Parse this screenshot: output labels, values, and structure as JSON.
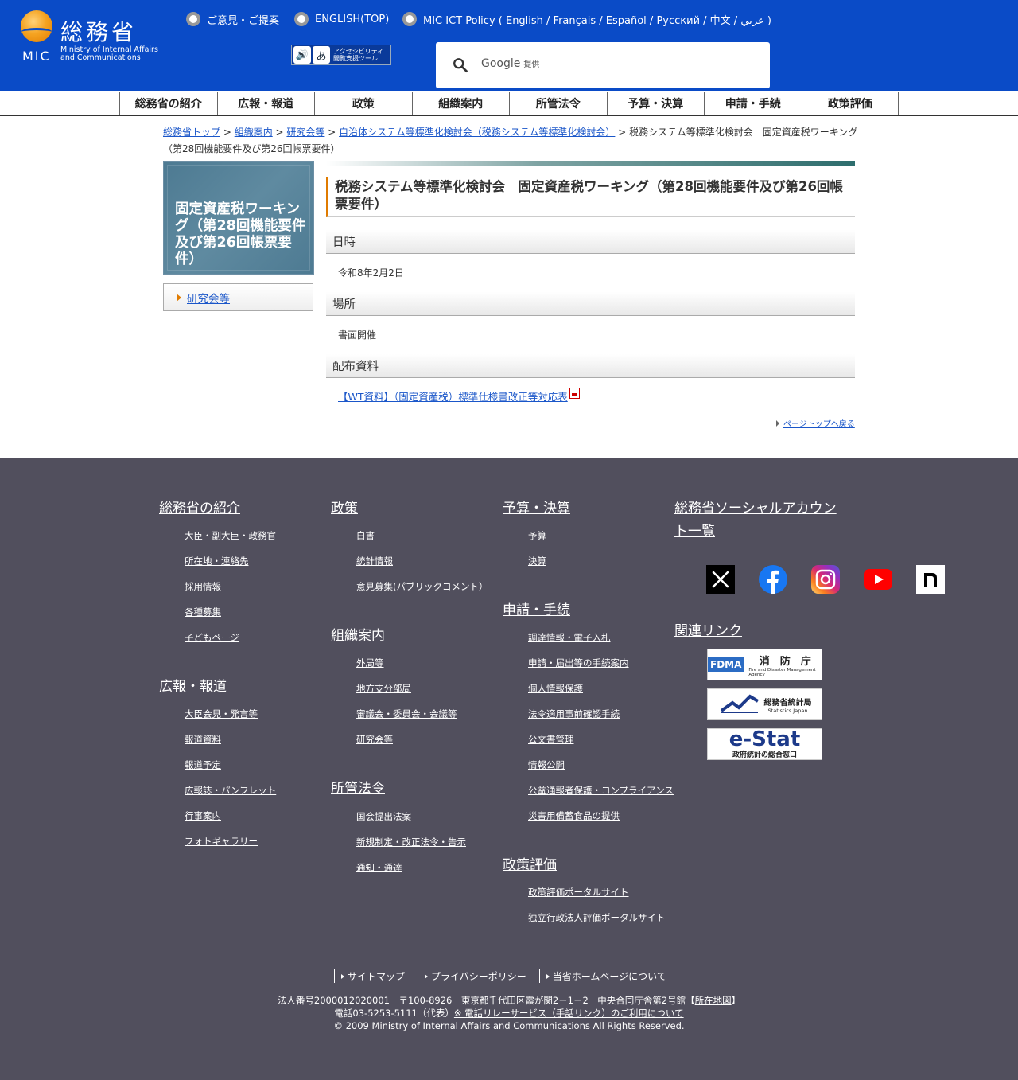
{
  "header": {
    "logo_kanji": "総務省",
    "logo_mic": "MIC",
    "logo_en1": "Ministry of Internal Affairs",
    "logo_en2": "and Communications",
    "links": [
      {
        "label": "ご意見・ご提案"
      },
      {
        "label": "ENGLISH(TOP)"
      },
      {
        "label": "MIC ICT Policy ( English / Français / Español / Русский / 中文 / عربي )"
      }
    ],
    "access_tool_line1": "アクセシビリティ",
    "access_tool_line2": "閲覧支援ツール",
    "search_brand": "Google",
    "search_suffix": "提供"
  },
  "gnav": [
    "総務省の紹介",
    "広報・報道",
    "政策",
    "組織案内",
    "所管法令",
    "予算・決算",
    "申請・手続",
    "政策評価"
  ],
  "breadcrumb": {
    "items": [
      "総務省トップ",
      "組織案内",
      "研究会等",
      "自治体システム等標準化検討会（税務システム等標準化検討会）"
    ],
    "sep": " > ",
    "current": "税務システム等標準化検討会　固定資産税ワーキング（第28回機能要件及び第26回帳票要件）"
  },
  "side": {
    "title": "固定資産税ワーキング（第28回機能要件及び第26回帳票要件）",
    "link": "研究会等"
  },
  "main": {
    "title": "税務システム等標準化検討会　固定資産税ワーキング（第28回機能要件及び第26回帳票要件）",
    "sections": [
      {
        "heading": "日時",
        "body": "令和8年2月2日"
      },
      {
        "heading": "場所",
        "body": "書面開催"
      },
      {
        "heading": "配布資料"
      }
    ],
    "pdf_link": "【WT資料】（固定資産税）標準仕様書改正等対応表",
    "pagetop": "ページトップへ戻る"
  },
  "footer": {
    "col1": [
      {
        "heading": "総務省の紹介",
        "items": [
          "大臣・副大臣・政務官",
          "所在地・連絡先",
          "採用情報",
          "各種募集",
          "子どもページ"
        ]
      },
      {
        "heading": "広報・報道",
        "items": [
          "大臣会見・発言等",
          "報道資料",
          "報道予定",
          "広報誌・パンフレット",
          "行事案内",
          "フォトギャラリー"
        ]
      }
    ],
    "col2": [
      {
        "heading": "政策",
        "items": [
          "白書",
          "統計情報",
          "意見募集(パブリックコメント）"
        ]
      },
      {
        "heading": "組織案内",
        "items": [
          "外局等",
          "地方支分部局",
          "審議会・委員会・会議等",
          "研究会等"
        ]
      },
      {
        "heading": "所管法令",
        "items": [
          "国会提出法案",
          "新規制定・改正法令・告示",
          "通知・通達"
        ]
      }
    ],
    "col3": [
      {
        "heading": "予算・決算",
        "items": [
          "予算",
          "決算"
        ]
      },
      {
        "heading": "申請・手続",
        "items": [
          "調達情報・電子入札",
          "申請・届出等の手続案内",
          "個人情報保護",
          "法令適用事前確認手続",
          "公文書管理",
          "情報公開",
          "公益通報者保護・コンプライアンス",
          "災害用備蓄食品の提供"
        ]
      },
      {
        "heading": "政策評価",
        "items": [
          "政策評価ポータルサイト",
          "独立行政法人評価ポータルサイト"
        ]
      }
    ],
    "social_heading_1": "総務省ソーシャルアカウン",
    "social_heading_2": "ト一覧",
    "social_icons": [
      "x-icon",
      "facebook-icon",
      "instagram-icon",
      "youtube-icon",
      "note-icon"
    ],
    "related_heading": "関連リンク",
    "banners": [
      {
        "main": "消　防　庁",
        "sub": "Fire and Disaster Management Agency",
        "logo": "FDMA"
      },
      {
        "main": "総務省統計局",
        "sub": "Statistics Japan"
      },
      {
        "main": "e-Stat",
        "sub": "政府統計の総合窓口"
      }
    ],
    "bottom_links": [
      "サイトマップ",
      "プライバシーポリシー",
      "当省ホームページについて"
    ],
    "address_line1_a": "法人番号2000012020001　〒100-8926　東京都千代田区霞が関2－1－2　中央合同庁舎第2号館【",
    "address_map": "所在地図",
    "address_line1_b": "】",
    "address_line2_a": "電話03-5253-5111（代表）",
    "address_relay": "※ 電話リレーサービス（手話リンク）のご利用について",
    "copyright": "© 2009 Ministry of Internal Affairs and Communications All Rights Reserved."
  }
}
